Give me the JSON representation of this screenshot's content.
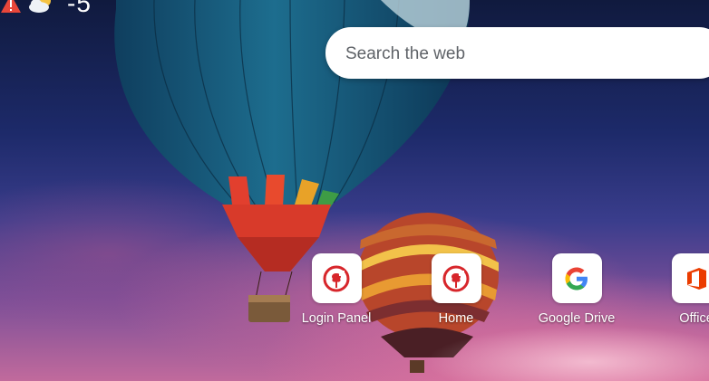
{
  "weather": {
    "temperature": "-5",
    "unit": "°",
    "alert_icon": "warning-icon",
    "condition_icon": "partly-cloudy-icon"
  },
  "search": {
    "placeholder": "Search the web"
  },
  "shortcuts": [
    {
      "label": "Login Panel",
      "icon": "red-tree-logo-icon"
    },
    {
      "label": "Home",
      "icon": "red-tree-logo-icon"
    },
    {
      "label": "Google Drive",
      "icon": "google-g-icon"
    },
    {
      "label": "Office",
      "icon": "office-logo-icon"
    }
  ],
  "colors": {
    "brand_red": "#d7262b",
    "google_blue": "#4285f4",
    "google_red": "#ea4335",
    "google_yellow": "#fbbc05",
    "google_green": "#34a853",
    "office_orange": "#eb3c00"
  }
}
